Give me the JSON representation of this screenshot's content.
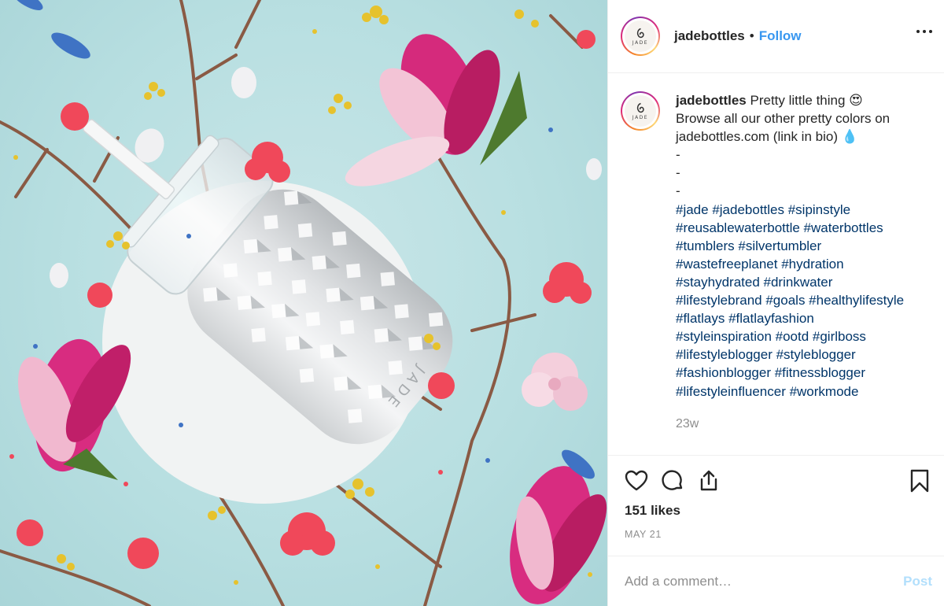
{
  "header": {
    "username": "jadebottles",
    "separator": "•",
    "follow_label": "Follow",
    "avatar_text": "JADE",
    "more_icon": "more-horizontal-icon"
  },
  "photo": {
    "bottle_text": "JADE"
  },
  "caption": {
    "username": "jadebottles",
    "lines": [
      "Pretty little thing 😍",
      "Browse all our other pretty colors on",
      "jadebottles.com (link in bio) 💧",
      "-",
      "-",
      "-"
    ],
    "hashtag_lines": [
      "#jade #jadebottles #sipinstyle",
      "#reusablewaterbottle #waterbottles",
      "#tumblers #silvertumbler",
      "#wastefreeplanet #hydration",
      "#stayhydrated #drinkwater",
      "#lifestylebrand #goals #healthylifestyle",
      "#flatlays #flatlayfashion",
      "#styleinspiration #ootd #girlboss",
      "#lifestyleblogger #styleblogger",
      "#fashionblogger #fitnessblogger",
      "#lifestyleinfluencer #workmode"
    ],
    "time": "23w"
  },
  "actions": {
    "icons": [
      "heart-icon",
      "comment-icon",
      "share-icon",
      "bookmark-icon"
    ],
    "likes": "151 likes",
    "date": "MAY 21"
  },
  "comment": {
    "placeholder": "Add a comment…",
    "post_label": "Post"
  },
  "colors": {
    "link": "#3897f0",
    "hashtag": "#003569",
    "muted": "#8e8e8e",
    "post_disabled": "#b2dffc",
    "photo_background": "#b8dfe1"
  }
}
